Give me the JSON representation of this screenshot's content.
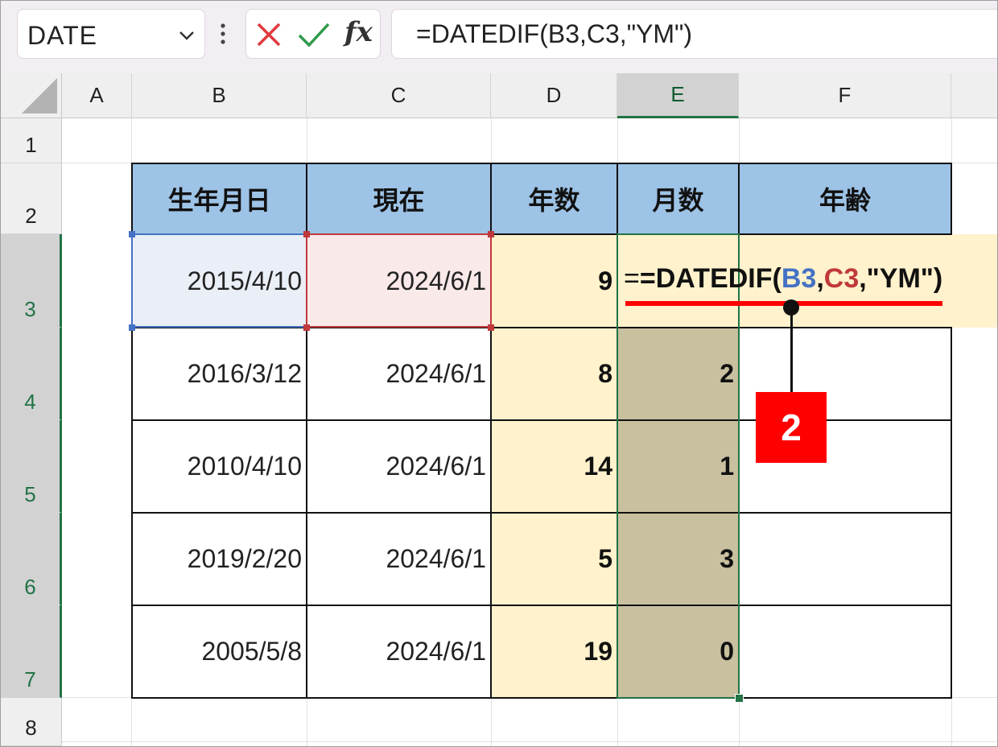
{
  "name_box": {
    "value": "DATE"
  },
  "formula_bar": {
    "cancel_icon": "cross-icon",
    "enter_icon": "check-icon",
    "fx_label": "fx",
    "formula": "=DATEDIF(B3,C3,\"YM\")"
  },
  "columns": [
    "A",
    "B",
    "C",
    "D",
    "E",
    "F"
  ],
  "rows": [
    "1",
    "2",
    "3",
    "4",
    "5",
    "6",
    "7",
    "8"
  ],
  "selected_column": "E",
  "table": {
    "headers": [
      "生年月日",
      "現在",
      "年数",
      "月数",
      "年齢"
    ],
    "rows": [
      {
        "birth": "2015/4/10",
        "now": "2024/6/1",
        "years": "9",
        "months": ""
      },
      {
        "birth": "2016/3/12",
        "now": "2024/6/1",
        "years": "8",
        "months": "2"
      },
      {
        "birth": "2010/4/10",
        "now": "2024/6/1",
        "years": "14",
        "months": "1"
      },
      {
        "birth": "2019/2/20",
        "now": "2024/6/1",
        "years": "5",
        "months": "3"
      },
      {
        "birth": "2005/5/8",
        "now": "2024/6/1",
        "years": "19",
        "months": "0"
      }
    ]
  },
  "edit_formula": {
    "prefix": "=DATEDIF(",
    "ref1": "B3",
    "sep1": ",",
    "ref2": "C3",
    "rest": ",\"YM\")"
  },
  "callout": {
    "number": "2"
  },
  "colors": {
    "header_fill": "#9dc3e6",
    "years_fill": "#fff2cc",
    "months_fill": "#c9c09f",
    "ref_blue": "#4472c4",
    "ref_red": "#c0393b",
    "callout_red": "#ff0000",
    "excel_green": "#217346"
  }
}
